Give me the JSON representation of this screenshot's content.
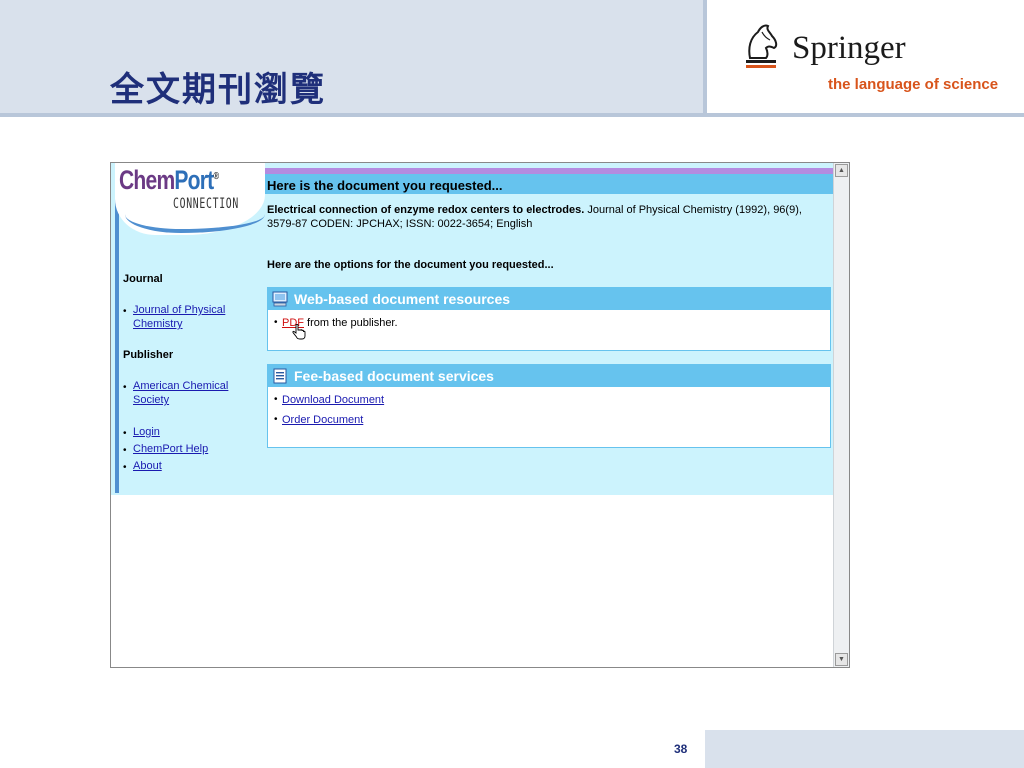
{
  "slide": {
    "title": "全文期刊瀏覽",
    "number": "38"
  },
  "springer": {
    "name": "Springer",
    "tagline": "the language of science"
  },
  "chemport": {
    "logo_chem": "Chem",
    "logo_port": "Port",
    "logo_reg": "®",
    "logo_sub": "CONNECTION",
    "sidebar": {
      "journal_heading": "Journal",
      "journal_link": "Journal of Physical Chemistry",
      "publisher_heading": "Publisher",
      "publisher_link": "American Chemical Society",
      "nav": [
        "Login",
        "ChemPort Help",
        "About"
      ]
    },
    "heading": "Here is the document you requested...",
    "citation_title": "Electrical connection of enzyme redox centers to electrodes.",
    "citation_rest": " Journal of Physical Chemistry (1992), 96(9), 3579-87 CODEN: JPCHAX; ISSN: 0022-3654; English",
    "options_line": "Here are the options for the document you requested...",
    "web_panel": {
      "title": "Web-based document resources",
      "pdf_link": "PDF",
      "pdf_suffix": " from the publisher."
    },
    "fee_panel": {
      "title": "Fee-based document services",
      "items": [
        "Download Document",
        "Order Document"
      ]
    }
  },
  "colors": {
    "slide_title": "#1f2f7a",
    "springer_tagline": "#d8541b",
    "chemport_bg": "#ccf3fd",
    "panel_header": "#66c3ee",
    "link": "#1a1ab0",
    "pdf_link": "#d01010"
  },
  "icons": [
    "springer-horse-icon",
    "monitor-icon",
    "document-icon",
    "hand-cursor-icon",
    "scroll-up-arrow-icon",
    "scroll-down-arrow-icon"
  ]
}
